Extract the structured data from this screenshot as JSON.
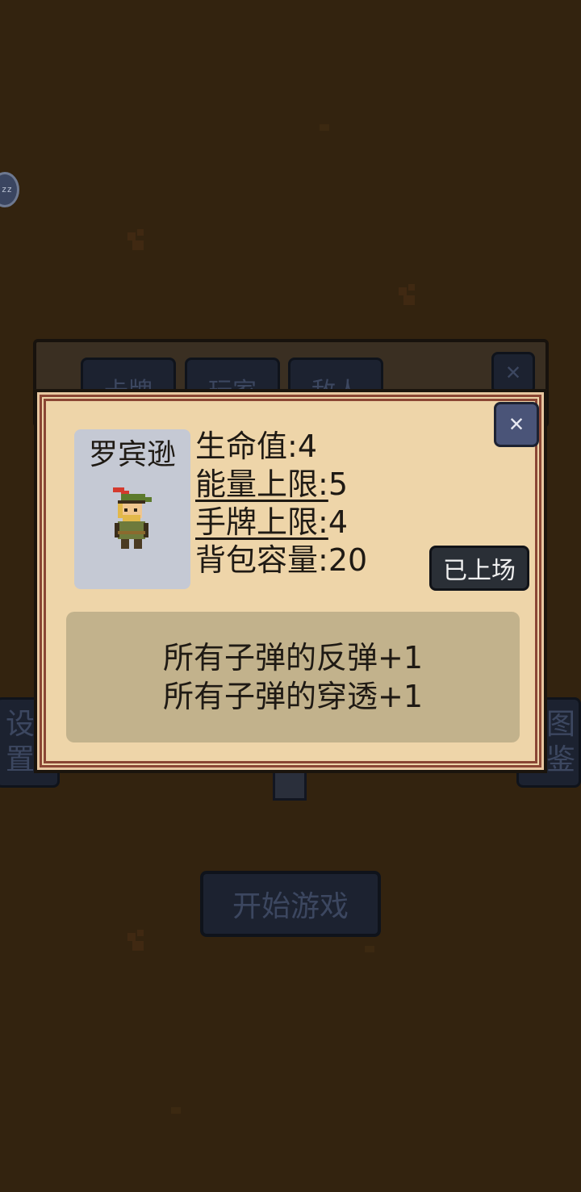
{
  "background": {
    "zz_badge": "zz",
    "settings_button": [
      "设",
      "置"
    ],
    "gallery_button": [
      "图",
      "鉴"
    ],
    "start_button": "开始游戏",
    "tabs": [
      "卡牌",
      "玩家",
      "敌人"
    ],
    "back_close": "✕"
  },
  "dialog": {
    "close_icon": "✕",
    "character_name": "罗宾逊",
    "stats": [
      {
        "label": "生命值:",
        "value": "4"
      },
      {
        "label": "能量上限:",
        "value": "5"
      },
      {
        "label": "手牌上限:",
        "value": "4"
      },
      {
        "label": "背包容量:",
        "value": "20"
      }
    ],
    "status_button": "已上场",
    "description": [
      "所有子弹的反弹+1",
      "所有子弹的穿透+1"
    ]
  },
  "colors": {
    "background": "#33230f",
    "dialog": "#eed5a9",
    "border_accent": "#8a4634",
    "close_button": "#4a5478",
    "description_box": "#c2b28c"
  }
}
